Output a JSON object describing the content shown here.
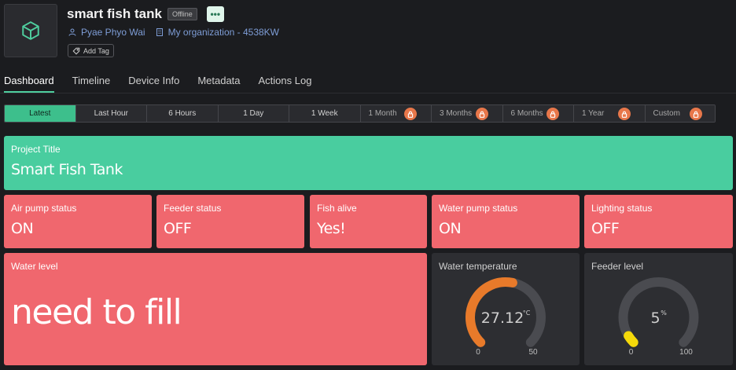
{
  "device": {
    "name": "smart fish tank",
    "status": "Offline",
    "owner": "Pyae Phyo Wai",
    "organization": "My organization - 4538KW",
    "add_tag": "Add Tag",
    "more_glyph": "•••"
  },
  "tabs": [
    "Dashboard",
    "Timeline",
    "Device Info",
    "Metadata",
    "Actions Log"
  ],
  "time_ranges": [
    {
      "label": "Latest",
      "locked": false,
      "active": true
    },
    {
      "label": "Last Hour",
      "locked": false
    },
    {
      "label": "6 Hours",
      "locked": false
    },
    {
      "label": "1 Day",
      "locked": false
    },
    {
      "label": "1 Week",
      "locked": false
    },
    {
      "label": "1 Month",
      "locked": true
    },
    {
      "label": "3 Months",
      "locked": true
    },
    {
      "label": "6 Months",
      "locked": true
    },
    {
      "label": "1 Year",
      "locked": true
    },
    {
      "label": "Custom",
      "locked": true
    }
  ],
  "widgets": {
    "project_title": {
      "label": "Project Title",
      "value": "Smart Fish Tank"
    },
    "air_pump": {
      "label": "Air pump status",
      "value": "ON"
    },
    "feeder_status": {
      "label": "Feeder status",
      "value": "OFF"
    },
    "fish_alive": {
      "label": "Fish alive",
      "value": "Yes!"
    },
    "water_pump": {
      "label": "Water pump status",
      "value": "ON"
    },
    "lighting": {
      "label": "Lighting status",
      "value": "OFF"
    },
    "water_level": {
      "label": "Water level",
      "value": "need to fill"
    },
    "water_temperature": {
      "label": "Water temperature",
      "value": "27.12",
      "unit": "°C",
      "min": "0",
      "max": "50",
      "fraction": 0.5424,
      "color": "#e87a2a"
    },
    "feeder_level": {
      "label": "Feeder level",
      "value": "5",
      "unit": "%",
      "min": "0",
      "max": "100",
      "fraction": 0.05,
      "color": "#f5d90a"
    }
  },
  "colors": {
    "accent": "#3dbf8c",
    "alert": "#f0676e",
    "lock": "#e8774a"
  },
  "icons": [
    "cube-icon",
    "user-icon",
    "building-icon",
    "tag-icon",
    "lock-icon"
  ]
}
